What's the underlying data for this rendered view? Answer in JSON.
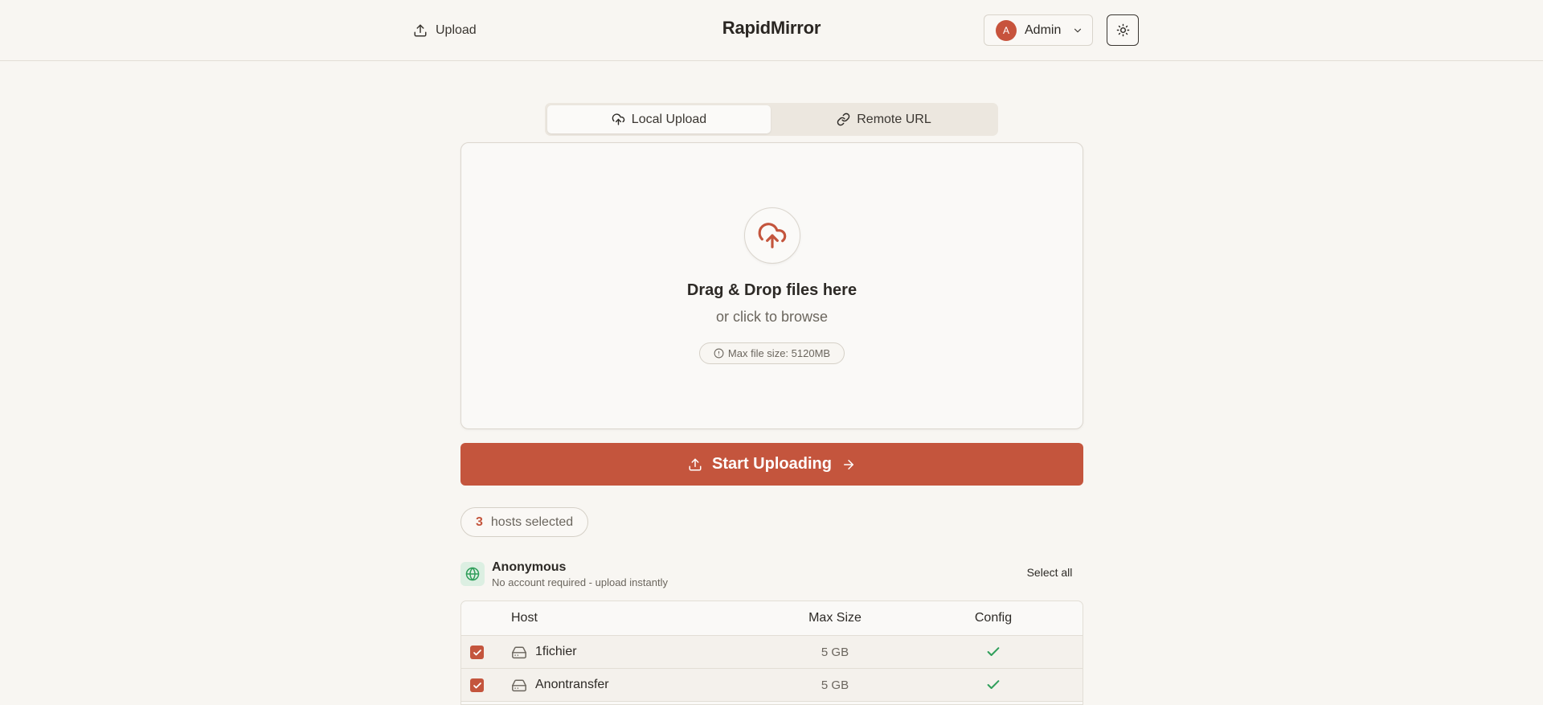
{
  "header": {
    "nav_upload_label": "Upload",
    "brand": "RapidMirror",
    "user": {
      "initial": "A",
      "name": "Admin"
    },
    "icons": {
      "upload": "upload-icon",
      "chevron": "chevron-down-icon",
      "theme": "sun-icon"
    }
  },
  "tabs": [
    {
      "label": "Local Upload",
      "icon": "cloud-upload-icon",
      "active": true
    },
    {
      "label": "Remote URL",
      "icon": "link-icon",
      "active": false
    }
  ],
  "dropzone": {
    "title": "Drag & Drop files here",
    "subtitle": "or click to browse",
    "max_size_label": "Max file size: 5120MB",
    "icon": "cloud-upload-icon"
  },
  "start_button": {
    "label": "Start Uploading",
    "icon": "upload-icon",
    "trailing_icon": "arrow-right-icon"
  },
  "hosts_selected": {
    "count": "3",
    "label": "hosts selected"
  },
  "group": {
    "title": "Anonymous",
    "subtitle": "No account required - upload instantly",
    "select_all": "Select all",
    "icon": "globe-icon"
  },
  "table": {
    "headers": {
      "host": "Host",
      "max_size": "Max Size",
      "config": "Config"
    },
    "rows": [
      {
        "checked": true,
        "name": "1fichier",
        "max_size": "5 GB",
        "config_ok": true
      },
      {
        "checked": true,
        "name": "Anontransfer",
        "max_size": "5 GB",
        "config_ok": true
      }
    ]
  },
  "colors": {
    "accent": "#c4553d",
    "background": "#f8f6f2",
    "success": "#2f9e5a"
  }
}
